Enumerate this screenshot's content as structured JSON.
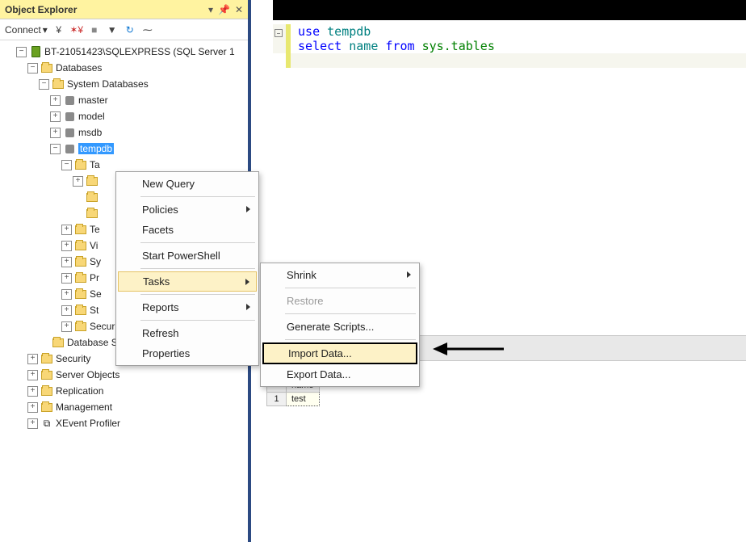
{
  "panel": {
    "title": "Object Explorer",
    "connect_label": "Connect",
    "root": "BT-21051423\\SQLEXPRESS (SQL Server 1",
    "databases": "Databases",
    "sysdb": "System Databases",
    "dbs": [
      "master",
      "model",
      "msdb",
      "tempdb"
    ],
    "tempdb_children": [
      "Ta",
      "Te",
      "Vi",
      "Sy",
      "Pr",
      "Se",
      "St",
      "Security"
    ],
    "snapshots": "Database Snapshots",
    "others": [
      "Security",
      "Server Objects",
      "Replication",
      "Management",
      "XEvent Profiler"
    ]
  },
  "ctx1": {
    "new_query": "New Query",
    "policies": "Policies",
    "facets": "Facets",
    "powershell": "Start PowerShell",
    "tasks": "Tasks",
    "reports": "Reports",
    "refresh": "Refresh",
    "properties": "Properties"
  },
  "ctx2": {
    "shrink": "Shrink",
    "restore": "Restore",
    "gen": "Generate Scripts...",
    "import": "Import Data...",
    "export": "Export Data..."
  },
  "code": {
    "line1": {
      "use": "use",
      "db": "tempdb"
    },
    "line2": {
      "select": "select",
      "name": "name",
      "from": "from",
      "sys": "sys.tables"
    }
  },
  "grid": {
    "col": "name",
    "row": "1",
    "val": "test"
  }
}
